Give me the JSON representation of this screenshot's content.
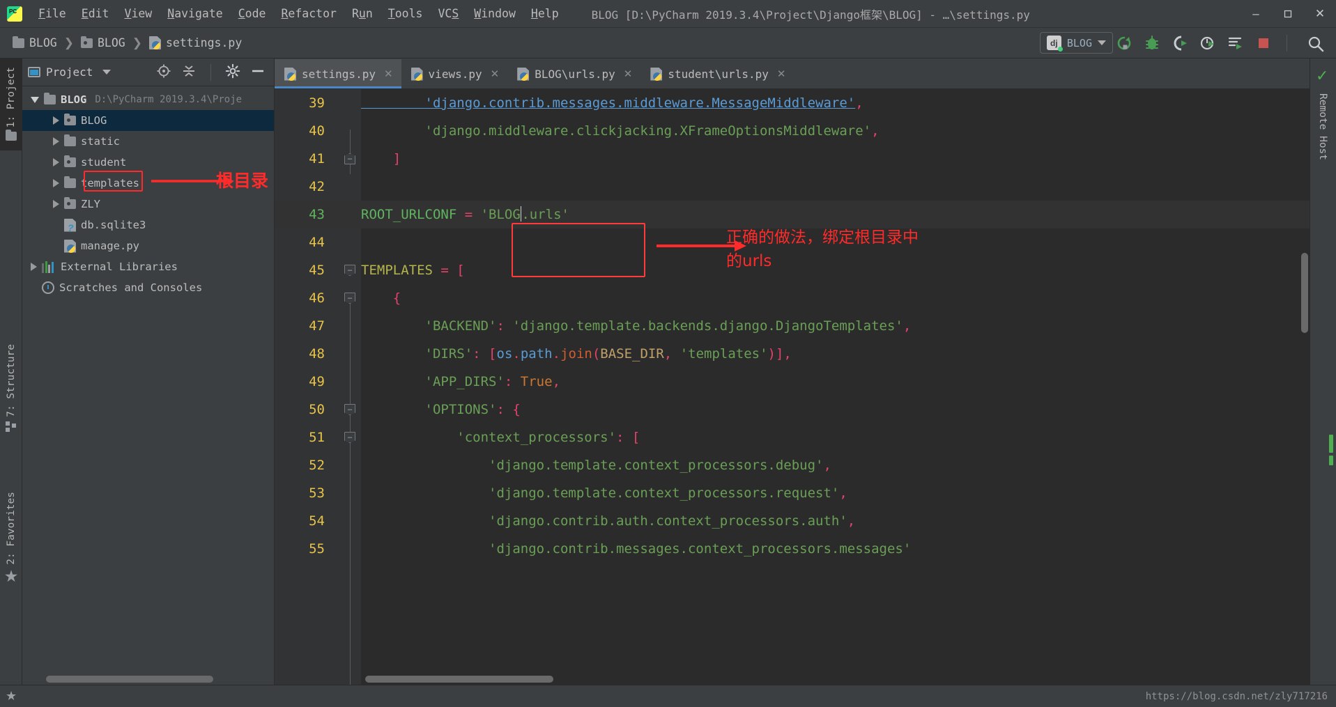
{
  "titlebar": {
    "logo": "pycharm-logo",
    "menus": [
      "File",
      "Edit",
      "View",
      "Navigate",
      "Code",
      "Refactor",
      "Run",
      "Tools",
      "VCS",
      "Window",
      "Help"
    ],
    "window_title": "BLOG [D:\\PyCharm 2019.3.4\\Project\\Django框架\\BLOG] - …\\settings.py",
    "controls": {
      "minimize": "–",
      "maximize": "❐",
      "close": "✕"
    }
  },
  "navbar": {
    "breadcrumbs": [
      {
        "label": "BLOG",
        "icon": "folder-icon"
      },
      {
        "label": "BLOG",
        "icon": "source-folder-icon"
      },
      {
        "label": "settings.py",
        "icon": "python-file-icon"
      }
    ],
    "run_config": {
      "label": "BLOG",
      "icon": "django-icon"
    },
    "toolbar_icons": [
      "rerun-icon",
      "debug-icon",
      "coverage-icon",
      "profile-icon",
      "run-with-console-icon",
      "stop-icon",
      "search-everywhere-icon"
    ]
  },
  "left_strips": [
    {
      "label": "1: Project",
      "icon": "project-icon",
      "active": true
    },
    {
      "label": "7: Structure",
      "icon": "structure-icon",
      "active": false
    },
    {
      "label": "2: Favorites",
      "icon": "star-icon",
      "active": false
    }
  ],
  "right_strips": [
    {
      "label": "Remote Host",
      "icon": "remote-host-icon"
    }
  ],
  "project_panel": {
    "title": "Project",
    "tools": [
      "locate-icon",
      "collapse-all-icon",
      "settings-gear-icon",
      "hide-icon"
    ],
    "tree": [
      {
        "label": "BLOG",
        "sub": "D:\\PyCharm 2019.3.4\\Proje",
        "icon": "folder-icon",
        "arrow": "open",
        "depth": 0,
        "bold": true,
        "selected": false
      },
      {
        "label": "BLOG",
        "sub": "",
        "icon": "source-folder-icon",
        "arrow": "closed",
        "depth": 1,
        "bold": false,
        "selected": true
      },
      {
        "label": "static",
        "sub": "",
        "icon": "folder-icon",
        "arrow": "closed",
        "depth": 1,
        "bold": false,
        "selected": false
      },
      {
        "label": "student",
        "sub": "",
        "icon": "source-folder-icon",
        "arrow": "closed",
        "depth": 1,
        "bold": false,
        "selected": false
      },
      {
        "label": "templates",
        "sub": "",
        "icon": "folder-icon",
        "arrow": "closed",
        "depth": 1,
        "bold": false,
        "selected": false
      },
      {
        "label": "ZLY",
        "sub": "",
        "icon": "source-folder-icon",
        "arrow": "closed",
        "depth": 1,
        "bold": false,
        "selected": false
      },
      {
        "label": "db.sqlite3",
        "sub": "",
        "icon": "unknown-file-icon",
        "arrow": "none",
        "depth": 1,
        "bold": false,
        "selected": false
      },
      {
        "label": "manage.py",
        "sub": "",
        "icon": "python-file-icon",
        "arrow": "none",
        "depth": 1,
        "bold": false,
        "selected": false
      },
      {
        "label": "External Libraries",
        "sub": "",
        "icon": "libraries-icon",
        "arrow": "closed",
        "depth": 0,
        "bold": false,
        "selected": false
      },
      {
        "label": "Scratches and Consoles",
        "sub": "",
        "icon": "scratches-icon",
        "arrow": "none",
        "depth": 0,
        "bold": false,
        "selected": false
      }
    ]
  },
  "editor": {
    "tabs": [
      {
        "label": "settings.py",
        "active": true
      },
      {
        "label": "views.py",
        "active": false
      },
      {
        "label": "BLOG\\urls.py",
        "active": false
      },
      {
        "label": "student\\urls.py",
        "active": false
      }
    ],
    "lines": [
      {
        "num": "39",
        "text": "        'django.contrib.messages.middleware.MessageMiddleware',"
      },
      {
        "num": "40",
        "text": "        'django.middleware.clickjacking.XFrameOptionsMiddleware',"
      },
      {
        "num": "41",
        "text": "    ]"
      },
      {
        "num": "42",
        "text": ""
      },
      {
        "num": "43",
        "text": "ROOT_URLCONF = 'BLOG.urls'"
      },
      {
        "num": "44",
        "text": ""
      },
      {
        "num": "45",
        "text": "TEMPLATES = ["
      },
      {
        "num": "46",
        "text": "    {"
      },
      {
        "num": "47",
        "text": "        'BACKEND': 'django.template.backends.django.DjangoTemplates',"
      },
      {
        "num": "48",
        "text": "        'DIRS': [os.path.join(BASE_DIR, 'templates')],"
      },
      {
        "num": "49",
        "text": "        'APP_DIRS': True,"
      },
      {
        "num": "50",
        "text": "        'OPTIONS': {"
      },
      {
        "num": "51",
        "text": "            'context_processors': ["
      },
      {
        "num": "52",
        "text": "                'django.template.context_processors.debug',"
      },
      {
        "num": "53",
        "text": "                'django.template.context_processors.request',"
      },
      {
        "num": "54",
        "text": "                'django.contrib.auth.context_processors.auth',"
      },
      {
        "num": "55",
        "text": "                'django.contrib.messages.context_processors.messages'"
      }
    ]
  },
  "annotations": {
    "tree_note": "根目录",
    "code_note_line1": "正确的做法，绑定根目录中",
    "code_note_line2": "的urls",
    "accent_red": "#ff2b2b"
  },
  "statusbar": {
    "url": "https://blog.csdn.net/zly717216"
  }
}
